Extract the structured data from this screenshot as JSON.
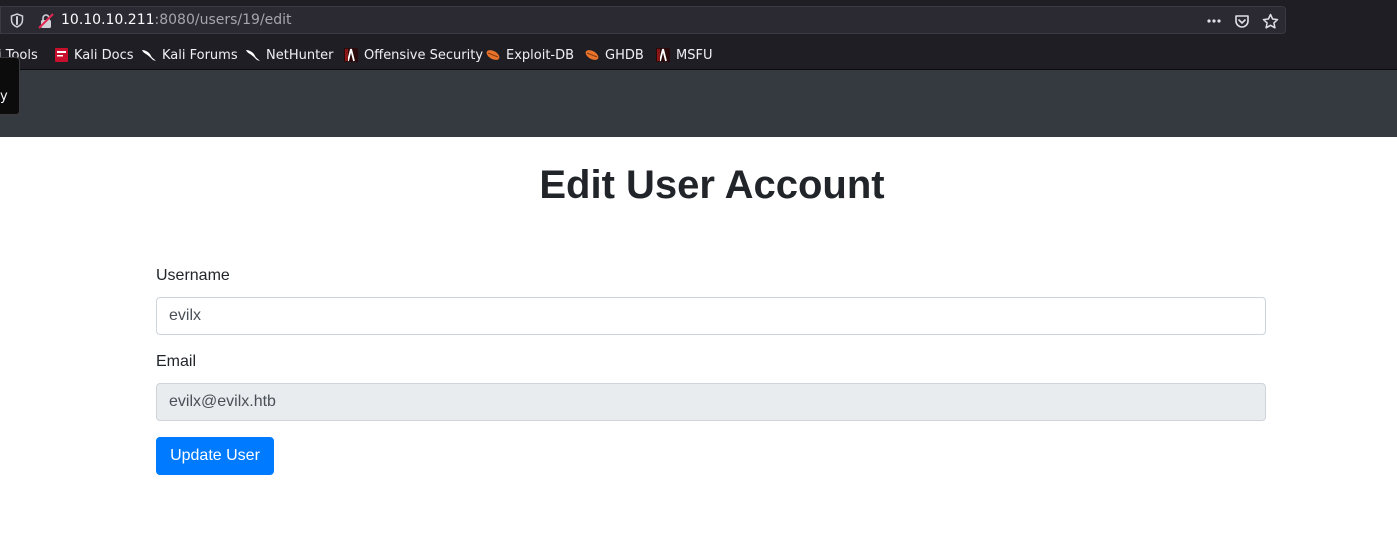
{
  "browser": {
    "url_host": "10.10.10.211",
    "url_rest": ":8080/users/19/edit",
    "icons": [
      "shield-icon",
      "insecure-lock-icon",
      "more-actions-icon",
      "pocket-icon",
      "bookmark-star-icon"
    ]
  },
  "bookmarks": [
    {
      "label": "i Tools",
      "icon": "kali-icon"
    },
    {
      "label": "Kali Docs",
      "icon": "kali-docs-icon"
    },
    {
      "label": "Kali Forums",
      "icon": "kali-dragon-icon"
    },
    {
      "label": "NetHunter",
      "icon": "kali-dragon-icon"
    },
    {
      "label": "Offensive Security",
      "icon": "offsec-icon"
    },
    {
      "label": "Exploit-DB",
      "icon": "exploitdb-icon"
    },
    {
      "label": "GHDB",
      "icon": "exploitdb-icon"
    },
    {
      "label": "MSFU",
      "icon": "offsec-icon"
    }
  ],
  "tooltip": {
    "text": "y"
  },
  "page": {
    "title": "Edit User Account",
    "username_label": "Username",
    "username_value": "evilx",
    "email_label": "Email",
    "email_value": "evilx@evilx.htb",
    "submit_label": "Update User"
  },
  "colors": {
    "primary": "#007bff",
    "navbar": "#343a40",
    "chrome": "#1f1e25"
  }
}
